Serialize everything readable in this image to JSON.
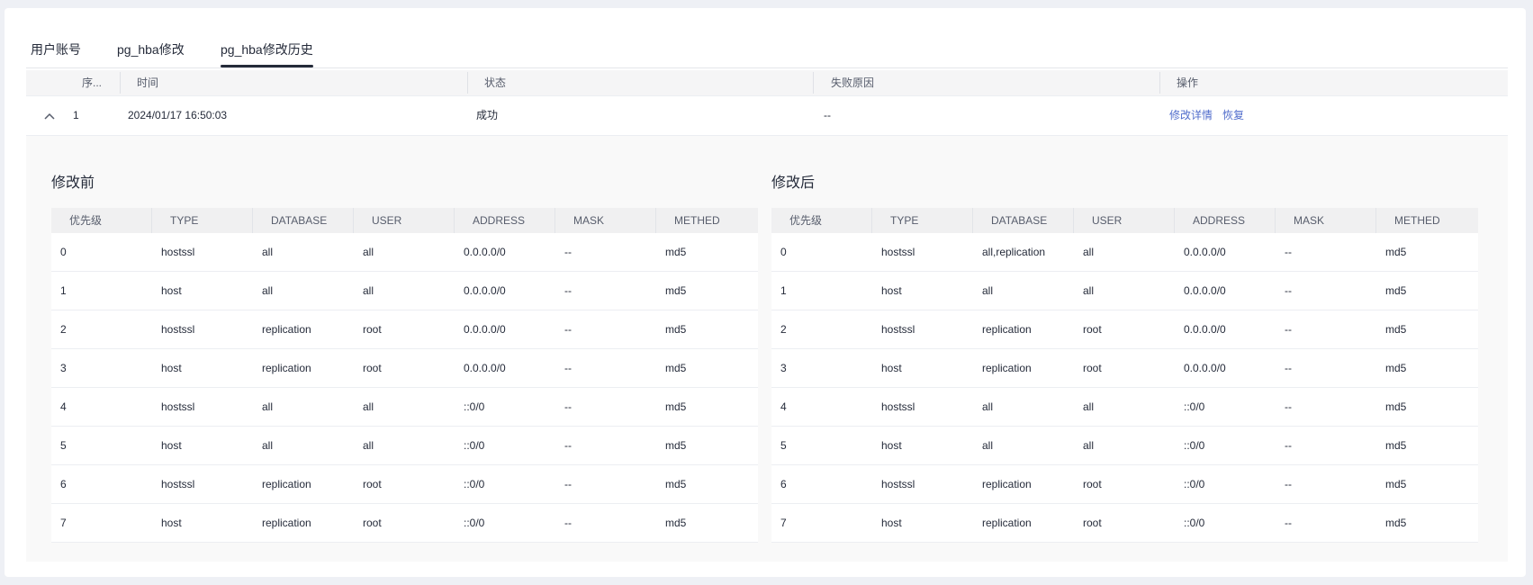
{
  "tabs": [
    {
      "label": "用户账号"
    },
    {
      "label": "pg_hba修改"
    },
    {
      "label": "pg_hba修改历史"
    }
  ],
  "history_table": {
    "headers": {
      "seq": "序...",
      "time": "时间",
      "status": "状态",
      "fail_reason": "失败原因",
      "ops": "操作"
    },
    "row": {
      "seq": "1",
      "time": "2024/01/17 16:50:03",
      "status": "成功",
      "fail_reason": "--",
      "detail_link": "修改详情",
      "restore_link": "恢复"
    }
  },
  "detail": {
    "before": {
      "title": "修改前",
      "headers": [
        "优先级",
        "TYPE",
        "DATABASE",
        "USER",
        "ADDRESS",
        "MASK",
        "METHED"
      ],
      "rows": [
        [
          "0",
          "hostssl",
          "all",
          "all",
          "0.0.0.0/0",
          "--",
          "md5"
        ],
        [
          "1",
          "host",
          "all",
          "all",
          "0.0.0.0/0",
          "--",
          "md5"
        ],
        [
          "2",
          "hostssl",
          "replication",
          "root",
          "0.0.0.0/0",
          "--",
          "md5"
        ],
        [
          "3",
          "host",
          "replication",
          "root",
          "0.0.0.0/0",
          "--",
          "md5"
        ],
        [
          "4",
          "hostssl",
          "all",
          "all",
          "::0/0",
          "--",
          "md5"
        ],
        [
          "5",
          "host",
          "all",
          "all",
          "::0/0",
          "--",
          "md5"
        ],
        [
          "6",
          "hostssl",
          "replication",
          "root",
          "::0/0",
          "--",
          "md5"
        ],
        [
          "7",
          "host",
          "replication",
          "root",
          "::0/0",
          "--",
          "md5"
        ]
      ]
    },
    "after": {
      "title": "修改后",
      "headers": [
        "优先级",
        "TYPE",
        "DATABASE",
        "USER",
        "ADDRESS",
        "MASK",
        "METHED"
      ],
      "rows": [
        [
          "0",
          "hostssl",
          "all,replication",
          "all",
          "0.0.0.0/0",
          "--",
          "md5"
        ],
        [
          "1",
          "host",
          "all",
          "all",
          "0.0.0.0/0",
          "--",
          "md5"
        ],
        [
          "2",
          "hostssl",
          "replication",
          "root",
          "0.0.0.0/0",
          "--",
          "md5"
        ],
        [
          "3",
          "host",
          "replication",
          "root",
          "0.0.0.0/0",
          "--",
          "md5"
        ],
        [
          "4",
          "hostssl",
          "all",
          "all",
          "::0/0",
          "--",
          "md5"
        ],
        [
          "5",
          "host",
          "all",
          "all",
          "::0/0",
          "--",
          "md5"
        ],
        [
          "6",
          "hostssl",
          "replication",
          "root",
          "::0/0",
          "--",
          "md5"
        ],
        [
          "7",
          "host",
          "replication",
          "root",
          "::0/0",
          "--",
          "md5"
        ]
      ]
    }
  },
  "icons": {
    "expand_toggle": "chevron-up-icon"
  },
  "colors": {
    "link": "#526ecc",
    "active_tab": "#252b3a"
  }
}
